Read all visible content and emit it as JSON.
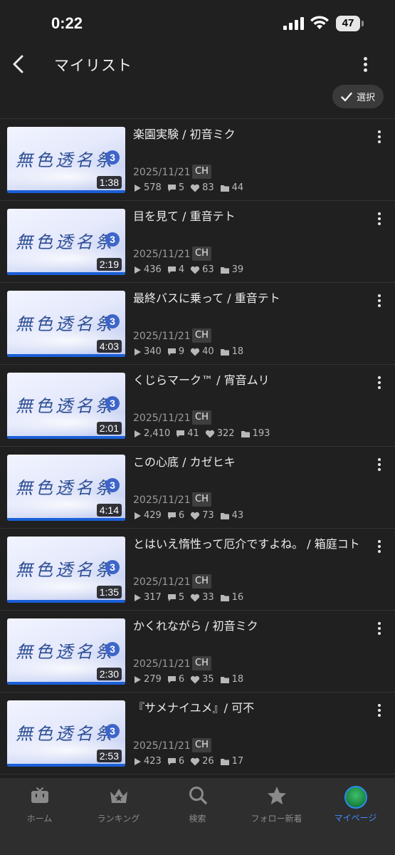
{
  "status_bar": {
    "time": "0:22",
    "battery": "47"
  },
  "header": {
    "title": "マイリスト"
  },
  "select_button": {
    "label": "選択"
  },
  "videos": [
    {
      "title": "楽園実験 / 初音ミク",
      "duration": "1:38",
      "date": "2025/11/21",
      "badge": "CH",
      "views": "578",
      "comments": "5",
      "likes": "83",
      "mylists": "44",
      "thumb_text": "無色透名祭",
      "thumb_number": "3"
    },
    {
      "title": "目を見て / 重音テト",
      "duration": "2:19",
      "date": "2025/11/21",
      "badge": "CH",
      "views": "436",
      "comments": "4",
      "likes": "63",
      "mylists": "39",
      "thumb_text": "無色透名祭",
      "thumb_number": "3"
    },
    {
      "title": "最終バスに乗って / 重音テト",
      "duration": "4:03",
      "date": "2025/11/21",
      "badge": "CH",
      "views": "340",
      "comments": "9",
      "likes": "40",
      "mylists": "18",
      "thumb_text": "無色透名祭",
      "thumb_number": "3"
    },
    {
      "title": "くじらマーク™ / 宵音ムリ",
      "duration": "2:01",
      "date": "2025/11/21",
      "badge": "CH",
      "views": "2,410",
      "comments": "41",
      "likes": "322",
      "mylists": "193",
      "thumb_text": "無色透名祭",
      "thumb_number": "3"
    },
    {
      "title": "この心底 / カゼヒキ",
      "duration": "4:14",
      "date": "2025/11/21",
      "badge": "CH",
      "views": "429",
      "comments": "6",
      "likes": "73",
      "mylists": "43",
      "thumb_text": "無色透名祭",
      "thumb_number": "3"
    },
    {
      "title": "とはいえ惰性って厄介ですよね。 / 箱庭コト",
      "duration": "1:35",
      "date": "2025/11/21",
      "badge": "CH",
      "views": "317",
      "comments": "5",
      "likes": "33",
      "mylists": "16",
      "thumb_text": "無色透名祭",
      "thumb_number": "3"
    },
    {
      "title": "かくれながら / 初音ミク",
      "duration": "2:30",
      "date": "2025/11/21",
      "badge": "CH",
      "views": "279",
      "comments": "6",
      "likes": "35",
      "mylists": "18",
      "thumb_text": "無色透名祭",
      "thumb_number": "3"
    },
    {
      "title": "『サメナイユメ』/ 可不",
      "duration": "2:53",
      "date": "2025/11/21",
      "badge": "CH",
      "views": "423",
      "comments": "6",
      "likes": "26",
      "mylists": "17",
      "thumb_text": "無色透名祭",
      "thumb_number": "3"
    }
  ],
  "nav": [
    {
      "label": "ホーム",
      "icon": "tv-icon",
      "active": false
    },
    {
      "label": "ランキング",
      "icon": "crown-icon",
      "active": false
    },
    {
      "label": "検索",
      "icon": "search-icon",
      "active": false
    },
    {
      "label": "フォロー新着",
      "icon": "star-icon",
      "active": false
    },
    {
      "label": "マイページ",
      "icon": "avatar-icon",
      "active": true
    }
  ],
  "colors": {
    "background": "#202020",
    "accent": "#3f8cff",
    "progress": "#1a5fd6"
  }
}
